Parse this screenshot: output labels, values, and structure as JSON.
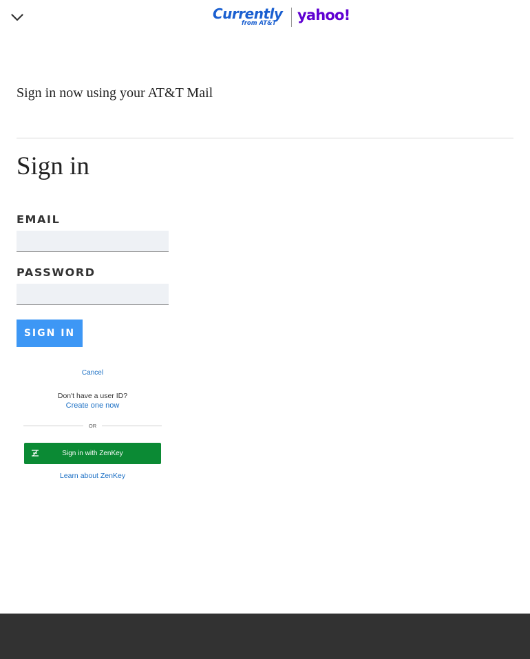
{
  "header": {
    "logo_currently": "Currently",
    "logo_currently_sub": "from AT&T",
    "logo_yahoo": "yahoo!"
  },
  "intro": "Sign in now using your AT&T Mail",
  "title": "Sign in",
  "form": {
    "email_label": "EMAIL",
    "email_value": "",
    "password_label": "PASSWORD",
    "password_value": "",
    "submit_label": "SIGN IN"
  },
  "panel": {
    "cancel": "Cancel",
    "no_id": "Don't have a user ID?",
    "create": "Create one now",
    "or": "OR",
    "zenkey_button": "Sign in with ZenKey",
    "learn": "Learn about ZenKey"
  },
  "colors": {
    "brand_blue": "#3d97f5",
    "zenkey_green": "#0b8a34",
    "link_blue": "#1b6fc4",
    "yahoo_purple": "#6001d2",
    "footer": "#323232"
  }
}
